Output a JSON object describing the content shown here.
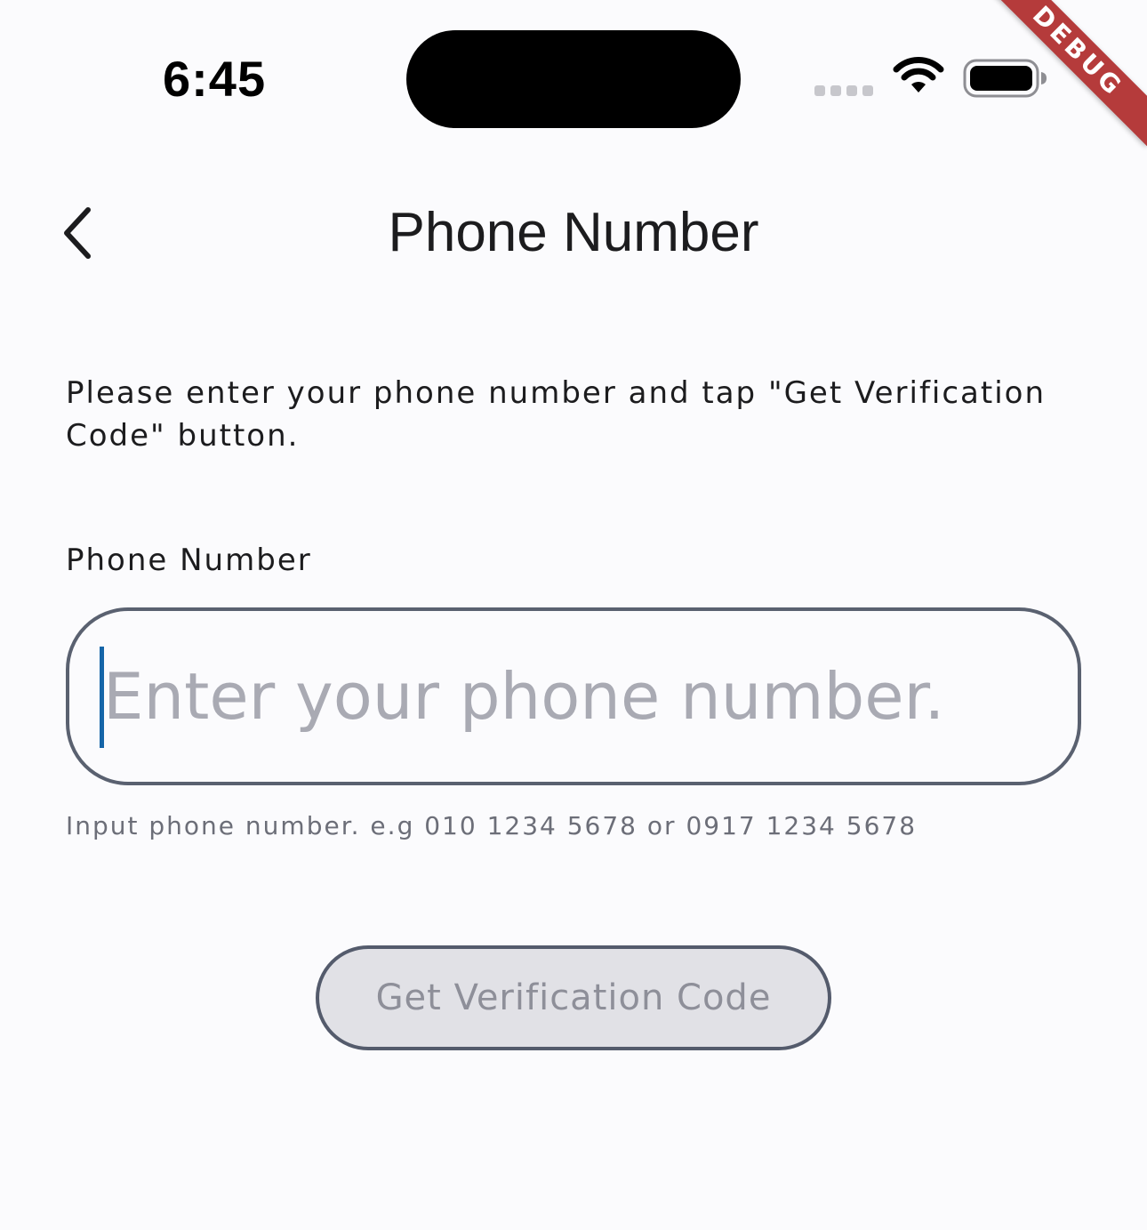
{
  "status_bar": {
    "time": "6:45",
    "signal_icon": "cellular-signal-icon",
    "wifi_icon": "wifi-icon",
    "battery_icon": "battery-icon"
  },
  "debug_banner": "DEBUG",
  "nav": {
    "back_icon": "chevron-left-icon",
    "title": "Phone Number"
  },
  "form": {
    "instructions": "Please enter your phone number and tap \"Get Verification Code\" button.",
    "phone_label": "Phone Number",
    "phone_value": "",
    "phone_placeholder": "Enter your phone number.",
    "helper": "Input phone number. e.g 010 1234 5678 or 0917 1234 5678",
    "submit_label": "Get Verification Code"
  },
  "colors": {
    "background": "#fbfbfd",
    "field_border": "#5a6170",
    "caret": "#1565a8",
    "button_fill_disabled": "#e1e1e6",
    "debug_ribbon": "#b53b3b"
  }
}
